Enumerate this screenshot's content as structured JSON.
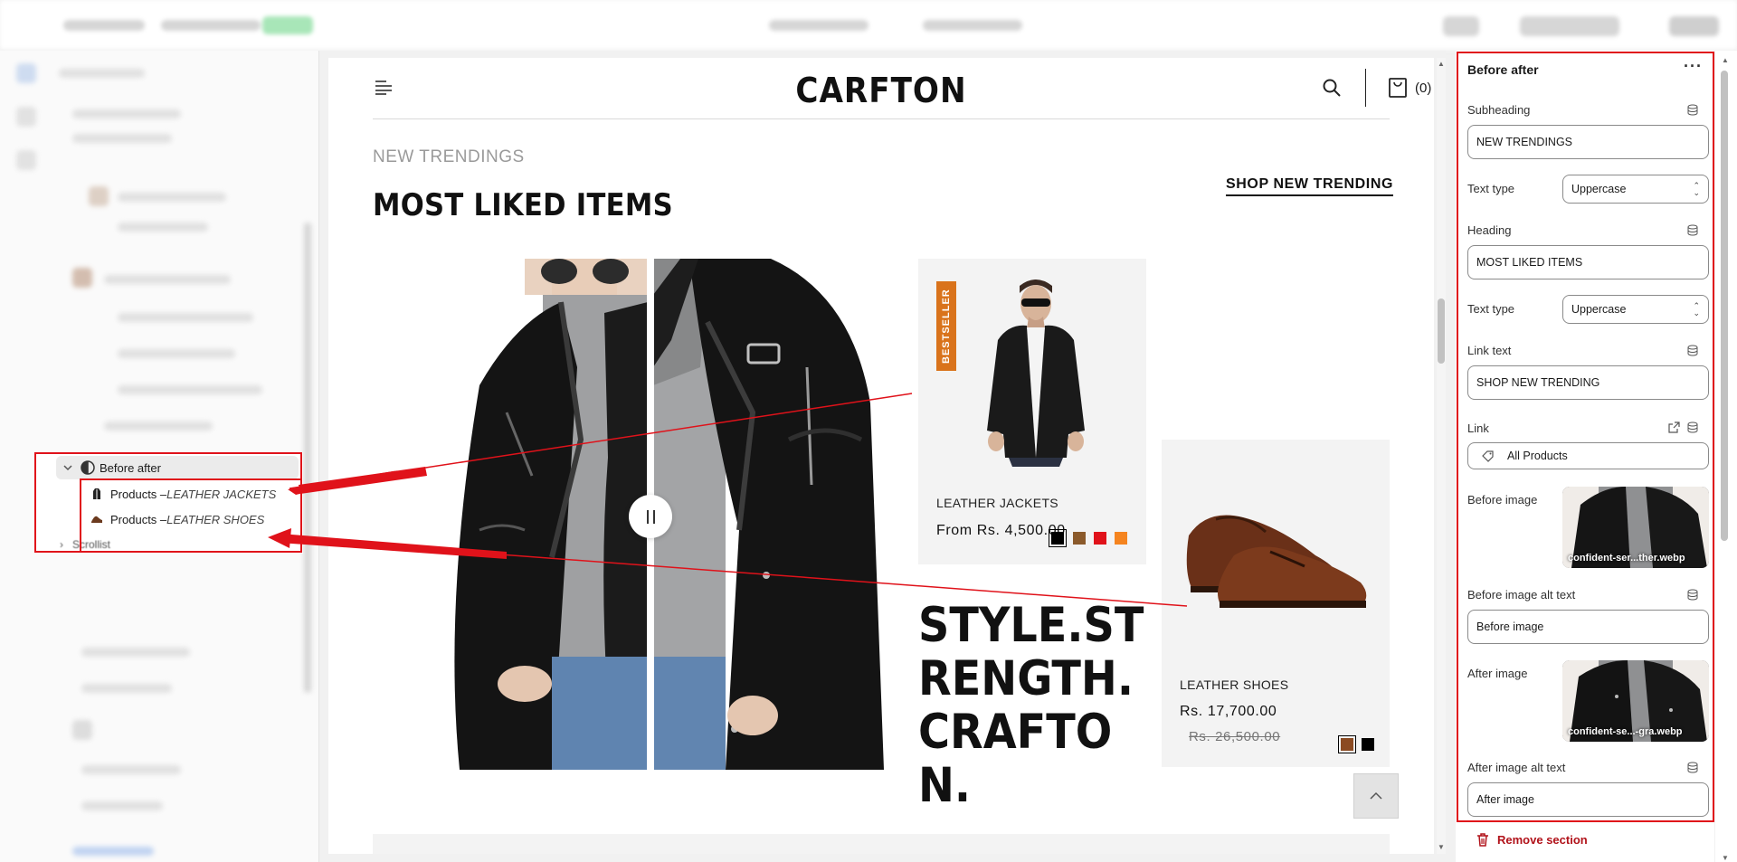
{
  "sidebar": {
    "tree_parent": "Before after",
    "tree_children": [
      {
        "prefix": "Products – ",
        "name": "LEATHER JACKETS"
      },
      {
        "prefix": "Products – ",
        "name": "LEATHER SHOES"
      }
    ],
    "next_item": "Scrollist"
  },
  "store": {
    "logo": "CARFTON",
    "cart_count": "(0)",
    "subheading": "NEW TRENDINGS",
    "heading": "MOST LIKED ITEMS",
    "link_text": "SHOP NEW TRENDING",
    "big_text": "STYLE.STRENGTH.CRAFTON.",
    "products": [
      {
        "badge": "BESTSELLER",
        "title": "LEATHER JACKETS",
        "price": "From Rs. 4,500.00",
        "swatches": [
          "#000000",
          "#8b5a2b",
          "#e0121a",
          "#f5841f"
        ]
      },
      {
        "title": "LEATHER SHOES",
        "price": "Rs. 17,700.00",
        "compare_price": "Rs. 26,500.00",
        "swatches": [
          "#8b4a22",
          "#000000"
        ]
      }
    ]
  },
  "panel": {
    "title": "Before after",
    "subheading_label": "Subheading",
    "subheading_value": "NEW TRENDINGS",
    "text_type_label": "Text type",
    "text_type_value": "Uppercase",
    "heading_label": "Heading",
    "heading_value": "MOST LIKED ITEMS",
    "text_type2_label": "Text type",
    "text_type2_value": "Uppercase",
    "link_text_label": "Link text",
    "link_text_value": "SHOP NEW TRENDING",
    "link_label": "Link",
    "link_value": "All Products",
    "before_image_label": "Before image",
    "before_image_file": "confident-ser...ther.webp",
    "before_alt_label": "Before image alt text",
    "before_alt_value": "Before image",
    "after_image_label": "After image",
    "after_image_file": "confident-se...-gra.webp",
    "after_alt_label": "After image alt text",
    "after_alt_value": "After image",
    "remove_label": "Remove section"
  },
  "colors": {
    "annotation_red": "#e0121a",
    "badge_orange": "#d9731b",
    "remove_red": "#b1121a"
  }
}
